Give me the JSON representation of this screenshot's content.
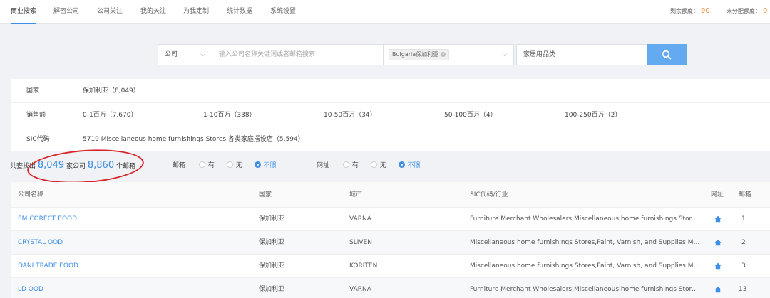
{
  "nav": {
    "tabs": [
      {
        "label": "商业搜索",
        "active": true
      },
      {
        "label": "解密公司",
        "active": false
      },
      {
        "label": "公司关注",
        "active": false
      },
      {
        "label": "我的关注",
        "active": false
      },
      {
        "label": "为我定制",
        "active": false
      },
      {
        "label": "统计数据",
        "active": false
      },
      {
        "label": "系统设置",
        "active": false
      }
    ],
    "quota_label": "剩余额度：",
    "quota_value": "90",
    "unassigned_label": "未分配额度：",
    "unassigned_value": "0"
  },
  "search": {
    "type_select": "公司",
    "keyword_placeholder": "输入公司名称关键词或者邮箱搜索",
    "country_tag": "Bulgaria保加利亚",
    "industry_value": "家居用品类",
    "search_icon": "search-icon"
  },
  "filters": {
    "country_label": "国家",
    "country_value": "保加利亚（8,049）",
    "sales_label": "销售额",
    "sales_options": [
      "0-1百万（7,670）",
      "1-10百万（338）",
      "10-50百万（34）",
      "50-100百万（4）",
      "100-250百万（2）"
    ],
    "sic_label": "SIC代码",
    "sic_value": "5719 Miscellaneous home furnishings Stores 各类家庭摆设店（5,594）"
  },
  "results": {
    "prefix": "共查找出",
    "company_count": "8,049",
    "mid": "家公司",
    "email_count": "8,860",
    "suffix": "个邮箱",
    "highlight_color": "#d6252a"
  },
  "email_filter": {
    "label": "邮箱",
    "options": [
      {
        "label": "有",
        "selected": false
      },
      {
        "label": "无",
        "selected": false
      },
      {
        "label": "不限",
        "selected": true
      }
    ]
  },
  "web_filter": {
    "label": "网址",
    "options": [
      {
        "label": "有",
        "selected": false
      },
      {
        "label": "无",
        "selected": false
      },
      {
        "label": "不限",
        "selected": true
      }
    ]
  },
  "table": {
    "headers": {
      "name": "公司名称",
      "country": "国家",
      "city": "城市",
      "sic": "SIC代码/行业",
      "web": "网址",
      "email": "邮箱"
    },
    "rows": [
      {
        "name": "EM CORECT EOOD",
        "country": "保加利亚",
        "city": "VARNA",
        "sic": "Furniture Merchant Wholesalers,Miscellaneous  home  furnishings  Stores,Home…",
        "email": "1"
      },
      {
        "name": "CRYSTAL OOD",
        "country": "保加利亚",
        "city": "SLIVEN",
        "sic": "Miscellaneous  home  furnishings  Stores,Paint, Varnish, and Supplies Merchant …",
        "email": "2"
      },
      {
        "name": "DANI TRADE EOOD",
        "country": "保加利亚",
        "city": "KORITEN",
        "sic": "Miscellaneous  home  furnishings  Stores,Paint, Varnish, and Supplies Merchant …",
        "email": "3"
      },
      {
        "name": "LD OOD",
        "country": "保加利亚",
        "city": "VARNA",
        "sic": "Furniture Merchant Wholesalers,Miscellaneous  home  furnishings  Stores,Home…",
        "email": "13"
      }
    ]
  },
  "colors": {
    "accent": "#3d8ee6",
    "button": "#64aaf0",
    "quota": "#f0883a"
  }
}
